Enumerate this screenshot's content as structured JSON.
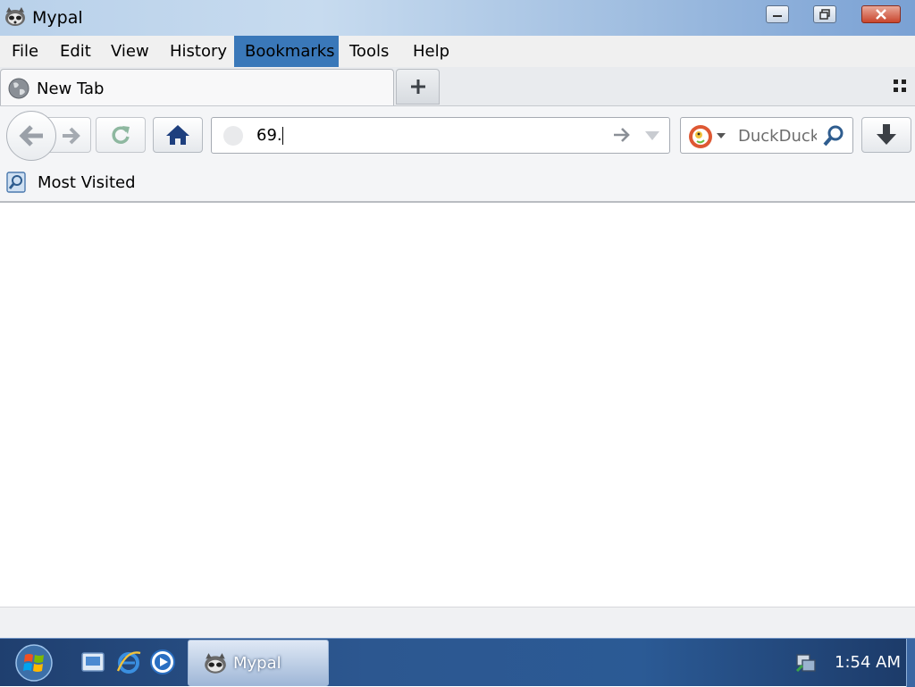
{
  "window": {
    "title": "Mypal"
  },
  "menu": [
    {
      "label": "File"
    },
    {
      "label": "Edit"
    },
    {
      "label": "View"
    },
    {
      "label": "History"
    },
    {
      "label": "Bookmarks"
    },
    {
      "label": "Tools"
    },
    {
      "label": "Help"
    }
  ],
  "menu_active": "Bookmarks",
  "tabs": [
    {
      "label": "New Tab"
    }
  ],
  "urlbar": {
    "value": "69."
  },
  "search": {
    "placeholder": "DuckDuckGo",
    "engine": "duckduckgo-icon"
  },
  "bookmarks": [
    {
      "label": "Most Visited"
    }
  ],
  "taskbar": {
    "task_label": "Mypal",
    "clock": "1:54 AM"
  },
  "colors": {
    "menu_highlight": "#3a78b9",
    "taskbar": "#2c5790"
  }
}
